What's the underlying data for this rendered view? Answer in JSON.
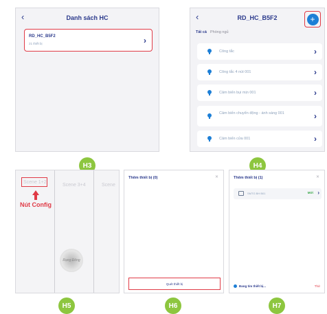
{
  "h3": {
    "title": "Danh sách HC",
    "back_icon": "chevron-left-icon",
    "item": {
      "name": "RD_HC_B5F2",
      "sub": "21 thiết bị"
    },
    "caption": "H3"
  },
  "h4": {
    "title": "RD_HC_B5F2",
    "tabs": [
      "Tất cả",
      "Phòng ngủ"
    ],
    "add_icon": "plus-icon",
    "devices": [
      "Công tắc",
      "Công tắc 4 nút 001",
      "Cảm biến bụi mịn 001",
      "Cảm biến chuyển động - ánh sáng 001",
      "Cảm biến cửa 001"
    ],
    "caption": "H4"
  },
  "h5": {
    "scenes": [
      "Scene 1+2",
      "Scene 3+4",
      "Scene"
    ],
    "annotation": "Nút Config",
    "device_text": "Rạng Đông",
    "caption": "H5"
  },
  "h6": {
    "dialog_title": "Thêm thiết bị (0)",
    "scan_button": "Quét thiết bị",
    "caption": "H6"
  },
  "h7": {
    "dialog_title": "Thêm thiết bị (1)",
    "device_name": "SMTG BH B01",
    "device_status": "Mới",
    "scanning_text": "Đang tìm thiết bị...",
    "stop": "Thử",
    "caption": "H7"
  },
  "colors": {
    "accent": "#2b3a8c",
    "highlight": "#e03a46",
    "badge": "#8dc63f",
    "icon_blue": "#1d7fd6"
  }
}
